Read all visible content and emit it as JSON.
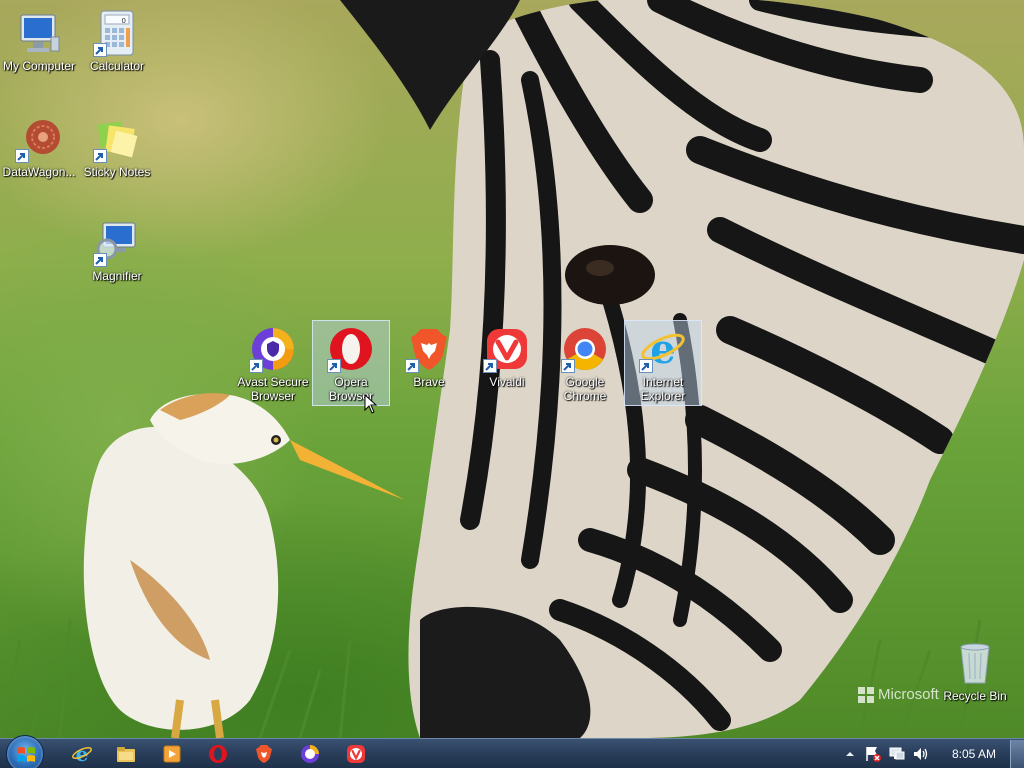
{
  "desktop_icons": [
    {
      "id": "my-computer",
      "label": "My Computer",
      "icon": "monitor-icon",
      "shortcut": false
    },
    {
      "id": "calculator",
      "label": "Calculator",
      "icon": "calculator-icon",
      "shortcut": true
    },
    {
      "id": "datawagon",
      "label": "DataWagon...",
      "icon": "datawagon-icon",
      "shortcut": true
    },
    {
      "id": "sticky-notes",
      "label": "Sticky Notes",
      "icon": "sticky-notes-icon",
      "shortcut": true
    },
    {
      "id": "magnifier",
      "label": "Magnifier",
      "icon": "magnifier-icon",
      "shortcut": true
    },
    {
      "id": "avast",
      "label": "Avast Secure Browser",
      "icon": "avast-browser-icon",
      "shortcut": true
    },
    {
      "id": "opera",
      "label": "Opera Browser",
      "icon": "opera-icon",
      "shortcut": true,
      "selected": true
    },
    {
      "id": "brave",
      "label": "Brave",
      "icon": "brave-icon",
      "shortcut": true
    },
    {
      "id": "vivaldi",
      "label": "Vivaldi",
      "icon": "vivaldi-icon",
      "shortcut": true
    },
    {
      "id": "chrome",
      "label": "Google Chrome",
      "icon": "chrome-icon",
      "shortcut": true
    },
    {
      "id": "ie",
      "label": "Internet Explorer",
      "icon": "internet-explorer-icon",
      "shortcut": true,
      "selected": true
    },
    {
      "id": "recycle-bin",
      "label": "Recycle Bin",
      "icon": "recycle-bin-icon",
      "shortcut": false
    }
  ],
  "watermark": {
    "text": "Microsoft"
  },
  "taskbar": {
    "start_icon": "windows-logo-icon",
    "pinned": [
      "internet-explorer-icon",
      "file-explorer-icon",
      "media-player-icon",
      "opera-icon",
      "brave-icon",
      "avast-browser-icon",
      "vivaldi-icon"
    ],
    "tray_icons": [
      "show-hidden-icons-icon",
      "action-center-icon",
      "network-icon",
      "volume-icon"
    ],
    "clock": "8:05 AM"
  },
  "colors": {
    "taskbar": "#2a3f5c",
    "opera_red": "#e0141e",
    "brave_orange": "#f1562b",
    "vivaldi_red": "#ef3939",
    "chrome_blue": "#4285f4"
  }
}
